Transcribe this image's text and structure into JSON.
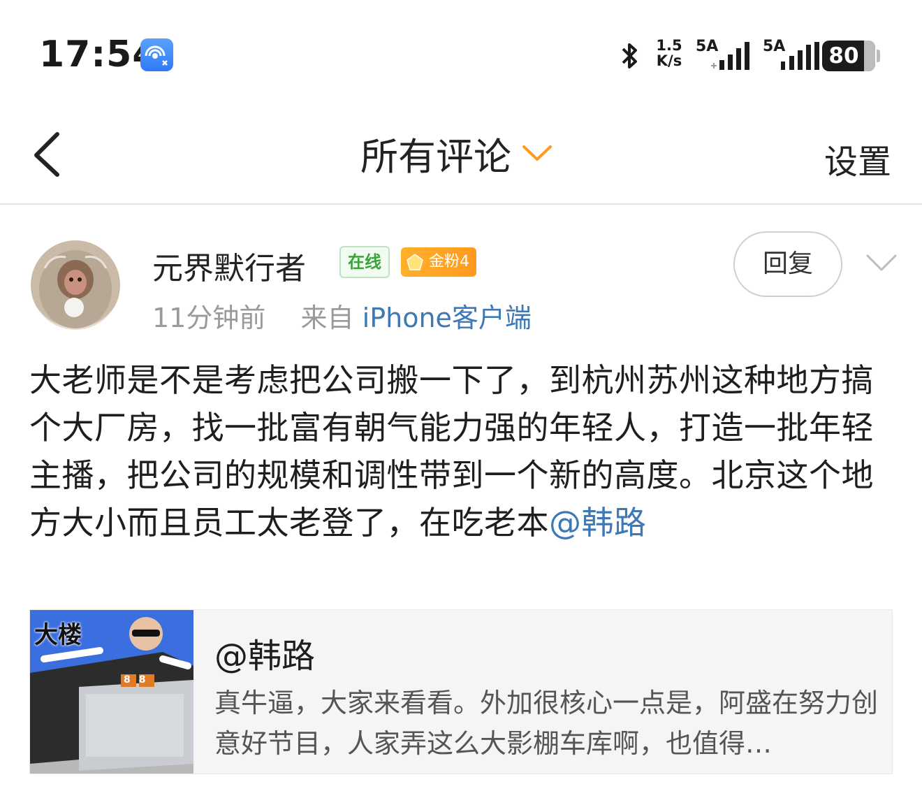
{
  "status_bar": {
    "time": "17:54",
    "net_speed_value": "1.5",
    "net_speed_unit": "K/s",
    "sim1_label": "5A",
    "sim2_label": "5A",
    "battery": "80",
    "battery_level": 0.8
  },
  "header": {
    "title": "所有评论",
    "settings_label": "设置"
  },
  "comment": {
    "username": "元界默行者",
    "badge_online": "在线",
    "badge_fan": "金粉4",
    "time_ago": "11分钟前",
    "source_prefix": "来自",
    "source": "iPhone客户端",
    "reply_label": "回复",
    "text": "大老师是不是考虑把公司搬一下了，到杭州苏州这种地方搞个大厂房，找一批富有朝气能力强的年轻人，打造一批年轻主播，把公司的规模和调性带到一个新的高度。北京这个地方大小而且员工太老登了，在吃老本",
    "mention": "@韩路"
  },
  "quote_card": {
    "title": "@韩路",
    "text": "真牛逼，大家来看看。外加很核心一点是，阿盛在努力创意好节目，人家弄这么大影棚车库啊，也值得…",
    "thumb_caption": "大楼",
    "thumb_sign": "88"
  },
  "colors": {
    "link": "#3d79b6",
    "accent_orange": "#ff9a1f",
    "online_green": "#3aa33a"
  }
}
